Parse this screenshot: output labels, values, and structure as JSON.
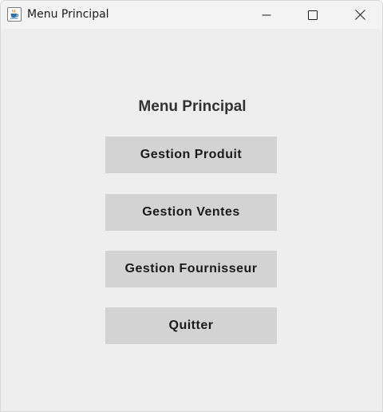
{
  "window": {
    "title": "Menu Principal",
    "controls": [
      "minimize",
      "maximize",
      "close"
    ],
    "app_icon": "java-cup-icon"
  },
  "main": {
    "heading": "Menu Principal",
    "buttons": [
      {
        "label": "Gestion Produit"
      },
      {
        "label": "Gestion Ventes"
      },
      {
        "label": "Gestion Fournisseur"
      },
      {
        "label": "Quitter"
      }
    ]
  },
  "colors": {
    "background": "#eeeeee",
    "button": "#d3d3d3",
    "heading_text": "#333333",
    "button_text": "#1a1a1a"
  }
}
